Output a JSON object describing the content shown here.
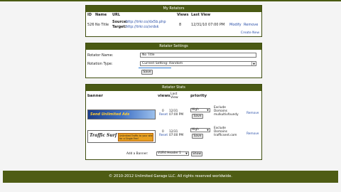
{
  "rotators": {
    "title": "My Rotators",
    "columns": {
      "id": "ID",
      "name": "Name",
      "url": "URL",
      "views": "Views",
      "last_view": "Last View"
    },
    "row": {
      "id": "526",
      "name": "No Title",
      "source_label": "Source:",
      "source_url": "http://trkr.co/dx5b.php",
      "target_label": "Target:",
      "target_url": "http://trkr.co/xrdsk",
      "views": "8",
      "last_view": "12/31/10 07:00 PM",
      "modify": "Modify",
      "remove": "Remove"
    },
    "manage": "Create New"
  },
  "settings": {
    "title": "Rotator Settings",
    "name_label": "Rotator Name:",
    "name_value": "No Title",
    "type_label": "Rotation Type:",
    "type_value": "Current Setting: Random",
    "save": "Save"
  },
  "stats": {
    "title": "Rotator Stats",
    "col_banner": "banner",
    "col_views": "views",
    "col_last_view": "Last View",
    "col_priority": "priority",
    "rows": [
      {
        "views": "0",
        "reset": "Reset",
        "last_view": "12/31",
        "last_time": "07:00 PM",
        "priority": "High",
        "save": "Save",
        "info1": "Exclude",
        "info2": "Domains",
        "info3": "mulkultivfoundy",
        "remove": "Remove"
      },
      {
        "views": "0",
        "reset": "Reset",
        "last_view": "12/31",
        "last_time": "07:00 PM",
        "priority": "High",
        "save": "Save",
        "info1": "Exclude",
        "info2": "Domains",
        "info3": "trafficsent.com",
        "remove": "Remove"
      }
    ],
    "add_label": "Add a Banner:",
    "add_select": "VUR4 Header 1",
    "add_button": "Show"
  },
  "banners": {
    "banner1_text": "Send Unlimited Ads",
    "banner2_logo": "Traffic Surf",
    "banner2_text": "Unlimited Traffic to your site for a Single Fee!"
  },
  "footer": {
    "text": "© 2010-2012 Unlimited Garage LLC. All rights reserved worldwide."
  },
  "colors": {
    "header_green": "#4a5a14",
    "link_blue": "#2a4fa8"
  }
}
